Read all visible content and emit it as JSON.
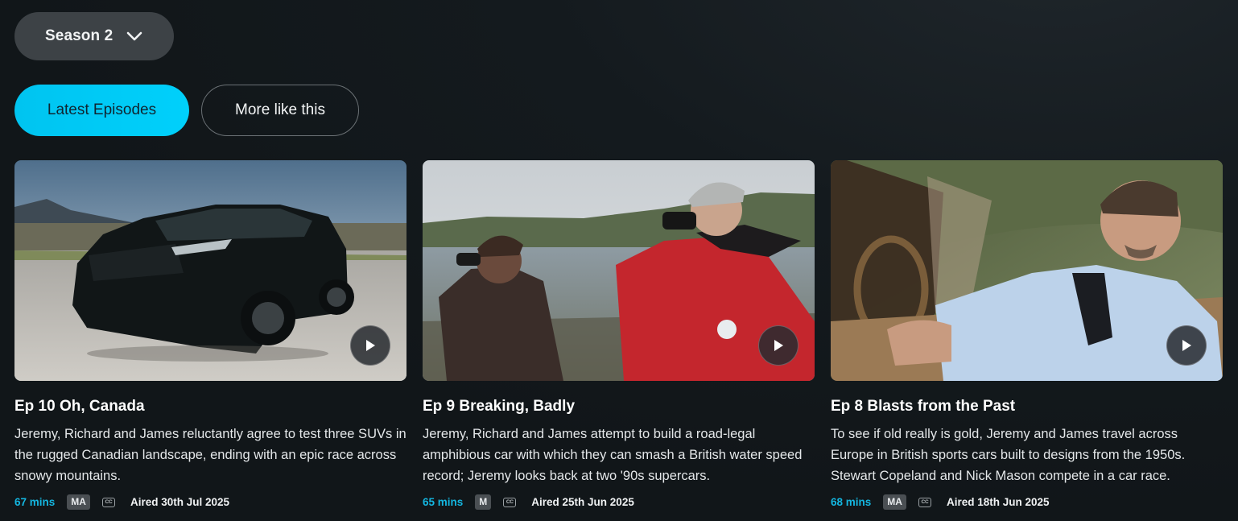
{
  "season_selector": {
    "label": "Season 2",
    "icon": "chevron-down-icon"
  },
  "tabs": [
    {
      "label": "Latest Episodes",
      "active": true
    },
    {
      "label": "More like this",
      "active": false
    }
  ],
  "colors": {
    "accent": "#00c8f5",
    "background": "#111619",
    "duration_text": "#14b6e0"
  },
  "episodes": [
    {
      "title": "Ep 10 Oh, Canada",
      "description": "Jeremy, Richard and James reluctantly agree to test three SUVs in the rugged Canadian landscape, ending with an epic race across snowy mountains.",
      "duration": "67 mins",
      "rating": "MA",
      "cc": "CC",
      "aired": "Aired 30th Jul 2025",
      "thumbnail": "black-suv-on-tarmac"
    },
    {
      "title": "Ep 9 Breaking, Badly",
      "description": "Jeremy, Richard and James attempt to build a road-legal amphibious car with which they can smash a British water speed record; Jeremy looks back at two '90s supercars.",
      "duration": "65 mins",
      "rating": "M",
      "cc": "CC",
      "aired": "Aired 25th Jun 2025",
      "thumbnail": "two-men-with-binoculars-by-shore"
    },
    {
      "title": "Ep 8 Blasts from the Past",
      "description": "To see if old really is gold, Jeremy and James travel across Europe in British sports cars built to designs from the 1950s. Stewart Copeland and Nick Mason compete in a car race.",
      "duration": "68 mins",
      "rating": "MA",
      "cc": "CC",
      "aired": "Aired 18th Jun 2025",
      "thumbnail": "man-driving-classic-convertible"
    }
  ]
}
